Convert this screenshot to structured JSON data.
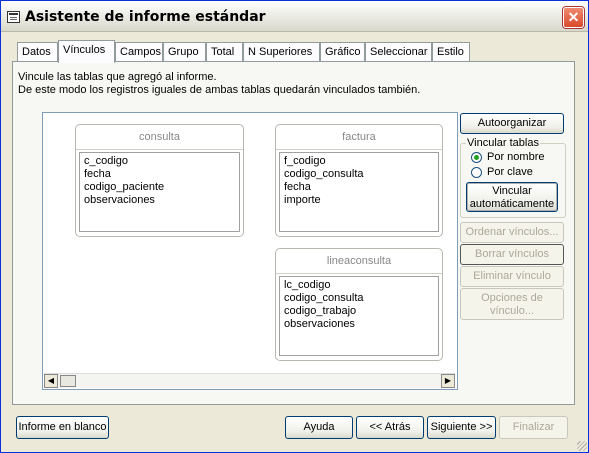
{
  "window": {
    "title": "Asistente de informe estándar"
  },
  "tabs": [
    {
      "label": "Datos"
    },
    {
      "label": "Vínculos"
    },
    {
      "label": "Campos"
    },
    {
      "label": "Grupo"
    },
    {
      "label": "Total"
    },
    {
      "label": "N Superiores"
    },
    {
      "label": "Gráfico"
    },
    {
      "label": "Seleccionar"
    },
    {
      "label": "Estilo"
    }
  ],
  "instructions": {
    "line1": "Vincule las tablas que agregó al informe.",
    "line2": "De este modo los registros iguales de ambas tablas quedarán vinculados también."
  },
  "tables": [
    {
      "name": "consulta",
      "fields": [
        "c_codigo",
        "fecha",
        "codigo_paciente",
        "observaciones"
      ]
    },
    {
      "name": "factura",
      "fields": [
        "f_codigo",
        "codigo_consulta",
        "fecha",
        "importe"
      ]
    },
    {
      "name": "lineaconsulta",
      "fields": [
        "lc_codigo",
        "codigo_consulta",
        "codigo_trabajo",
        "observaciones"
      ]
    }
  ],
  "side": {
    "autoorganizar": "Autoorganizar",
    "vincular_group": "Vincular tablas",
    "por_nombre": "Por nombre",
    "por_clave": "Por clave",
    "vincular_auto_1": "Vincular",
    "vincular_auto_2": "automáticamente",
    "ordenar": "Ordenar vínculos...",
    "borrar": "Borrar vínculos",
    "eliminar": "Eliminar vínculo",
    "opciones_1": "Opciones de",
    "opciones_2": "vínculo..."
  },
  "footer": {
    "informe_blanco": "Informe en blanco",
    "ayuda": "Ayuda",
    "atras": "<< Atrás",
    "siguiente": "Siguiente >>",
    "finalizar": "Finalizar"
  }
}
